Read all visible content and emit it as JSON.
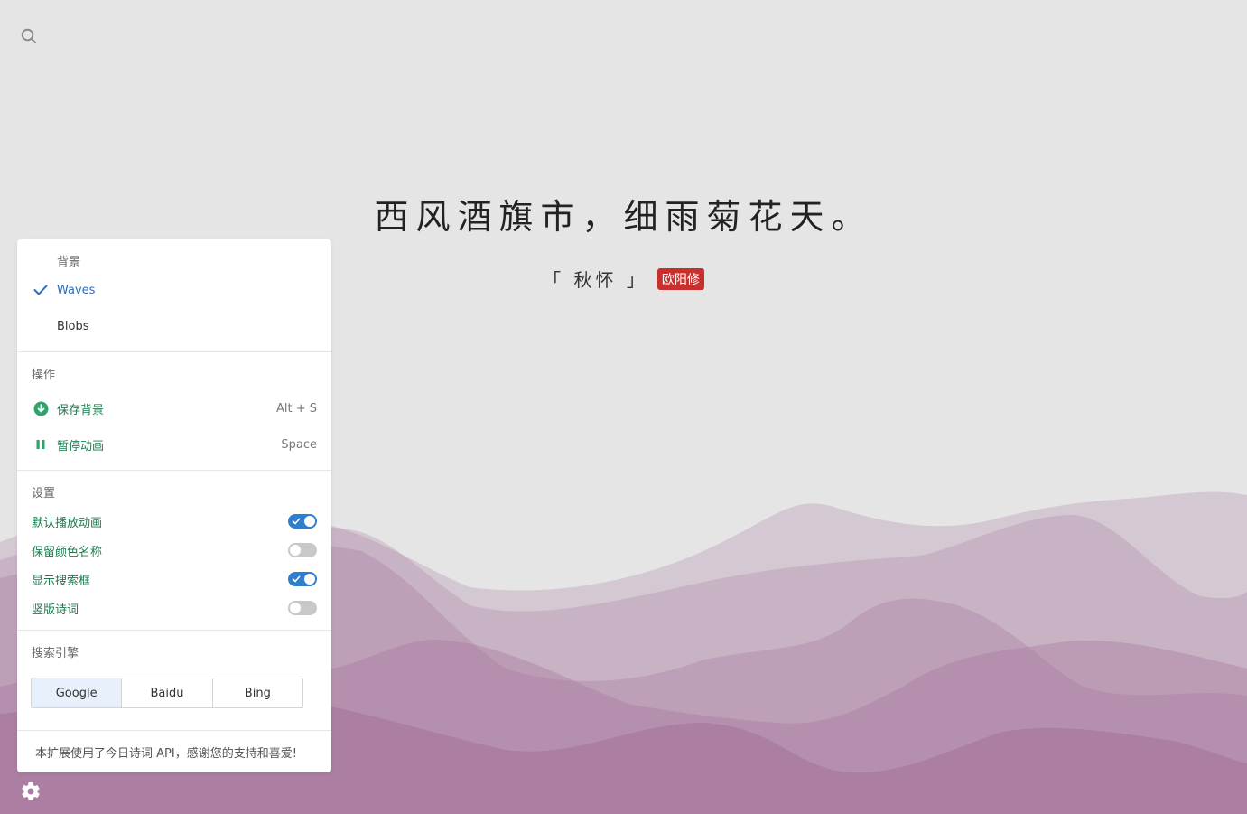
{
  "poem": {
    "line": "西风酒旗市，细雨菊花天。",
    "title": "「 秋怀 」",
    "author": "欧阳修"
  },
  "panel": {
    "background": {
      "title": "背景",
      "items": [
        {
          "label": "Waves",
          "checked": true
        },
        {
          "label": "Blobs",
          "checked": false
        }
      ]
    },
    "actions": {
      "title": "操作",
      "items": [
        {
          "label": "保存背景",
          "shortcut": "Alt + S",
          "icon": "download-circle-icon"
        },
        {
          "label": "暂停动画",
          "shortcut": "Space",
          "icon": "pause-icon"
        }
      ]
    },
    "settings": {
      "title": "设置",
      "items": [
        {
          "label": "默认播放动画",
          "on": true
        },
        {
          "label": "保留颜色名称",
          "on": false
        },
        {
          "label": "显示搜索框",
          "on": true
        },
        {
          "label": "竖版诗词",
          "on": false
        }
      ]
    },
    "search_engine": {
      "title": "搜索引擎",
      "options": [
        "Google",
        "Baidu",
        "Bing"
      ],
      "selected": "Google"
    },
    "footer": "本扩展使用了今日诗词 API，感谢您的支持和喜爱!"
  },
  "colors": {
    "accent_blue": "#2f7fd1",
    "action_green": "#1e7b4f",
    "author_red": "#c8302e",
    "wave_color": "#a5739a",
    "background": "#e5e5e5"
  }
}
